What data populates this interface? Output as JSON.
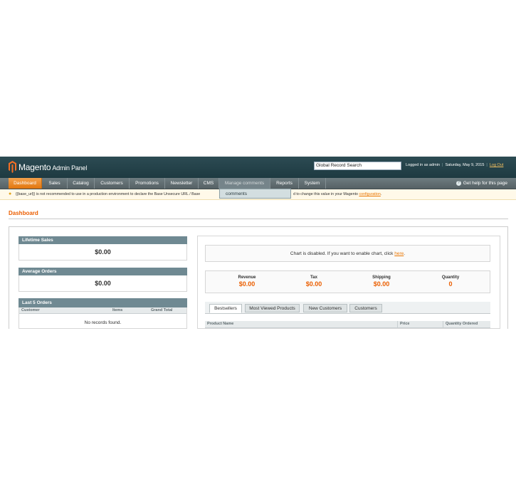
{
  "header": {
    "logo_brand": "Magento",
    "logo_product": "Admin Panel",
    "search_value": "Global Record Search",
    "logged_in": "Logged in as admin",
    "date": "Saturday, May 9, 2015",
    "logout": "Log Out"
  },
  "nav": {
    "items": [
      "Dashboard",
      "Sales",
      "Catalog",
      "Customers",
      "Promotions",
      "Newsletter",
      "CMS",
      "Manage comments",
      "Reports",
      "System"
    ],
    "help": "Get help for this page",
    "dropdown_item": "comments"
  },
  "notice": {
    "text_left": "{{base_url}} is not recommended to use in a production environment to declare the Base Unsecure URL / Base",
    "text_right": "d to change this value in your Magento",
    "link": "configuration",
    "tail": "."
  },
  "page_title": "Dashboard",
  "left": {
    "lifetime_sales_label": "Lifetime Sales",
    "lifetime_sales_value": "$0.00",
    "average_orders_label": "Average Orders",
    "average_orders_value": "$0.00",
    "last_orders_label": "Last 5 Orders",
    "columns": [
      "Customer",
      "Items",
      "Grand Total"
    ],
    "no_records": "No records found."
  },
  "right": {
    "chart_text": "Chart is disabled. If you want to enable chart, click",
    "chart_link": "here",
    "chart_tail": ".",
    "totals": [
      {
        "label": "Revenue",
        "value": "$0.00"
      },
      {
        "label": "Tax",
        "value": "$0.00"
      },
      {
        "label": "Shipping",
        "value": "$0.00"
      },
      {
        "label": "Quantity",
        "value": "0"
      }
    ],
    "tabs": [
      "Bestsellers",
      "Most Viewed Products",
      "New Customers",
      "Customers"
    ],
    "columns": [
      "Product Name",
      "Price",
      "Quantity Ordered"
    ]
  },
  "colors": {
    "accent": "#eb5e00",
    "header_bg": "#1e3a41",
    "nav_active": "#e2760e"
  }
}
